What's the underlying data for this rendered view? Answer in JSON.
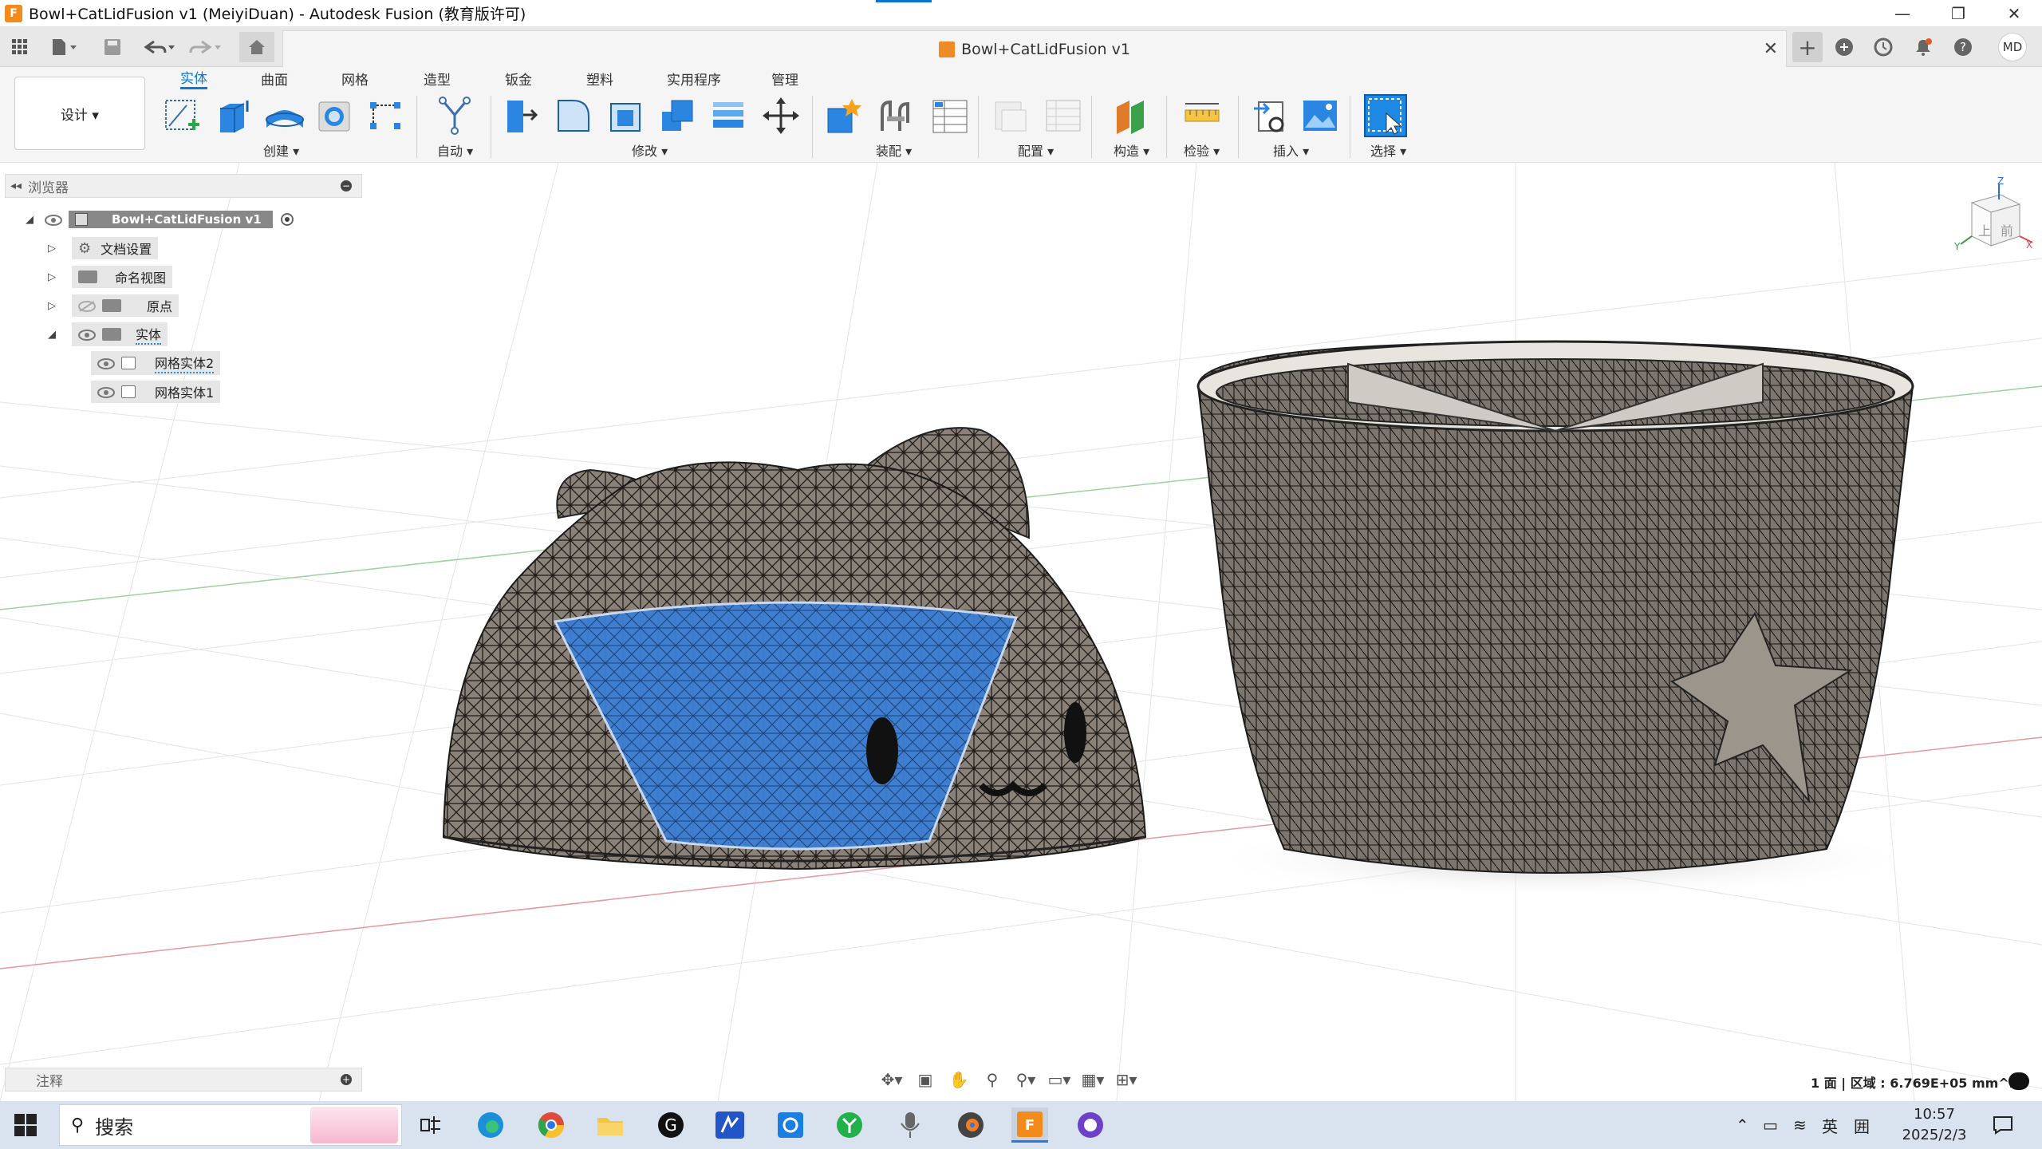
{
  "window": {
    "title": "Bowl+CatLidFusion v1 (MeiyiDuan) - Autodesk Fusion (教育版许可)",
    "app_icon": "F",
    "controls": [
      "—",
      "❐",
      "✕"
    ]
  },
  "appbar": {
    "doc_tab_label": "Bowl+CatLidFusion v1",
    "avatar_initials": "MD"
  },
  "toolbar": {
    "workspace_label": "设计 ▾",
    "tabs": [
      "实体",
      "曲面",
      "网格",
      "造型",
      "钣金",
      "塑料",
      "实用程序",
      "管理"
    ],
    "active_tab": "实体",
    "groups": [
      "创建 ▾",
      "自动 ▾",
      "修改 ▾",
      "装配 ▾",
      "配置 ▾",
      "构造 ▾",
      "检验 ▾",
      "插入 ▾",
      "选择 ▾"
    ]
  },
  "browser": {
    "title": "浏览器",
    "root": "Bowl+CatLidFusion v1",
    "items": [
      "文档设置",
      "命名视图",
      "原点",
      "实体"
    ],
    "bodies": [
      "网格实体2",
      "网格实体1"
    ]
  },
  "viewcube": {
    "top": "上",
    "front": "前",
    "axis_z": "Z",
    "axis_x": "X",
    "axis_y": "Y"
  },
  "notes": {
    "title": "注释"
  },
  "status": {
    "text": "1 面 | 区域 : 6.769E+05 mm^2"
  },
  "taskbar": {
    "search_placeholder": "搜索",
    "ime": "英",
    "ime2": "囲",
    "time": "10:57",
    "date": "2025/2/3"
  },
  "colors": {
    "accent": "#0a7ad6",
    "brand": "#f28a1c",
    "mesh": "#8a8178",
    "selection": "#3a7fd8"
  }
}
